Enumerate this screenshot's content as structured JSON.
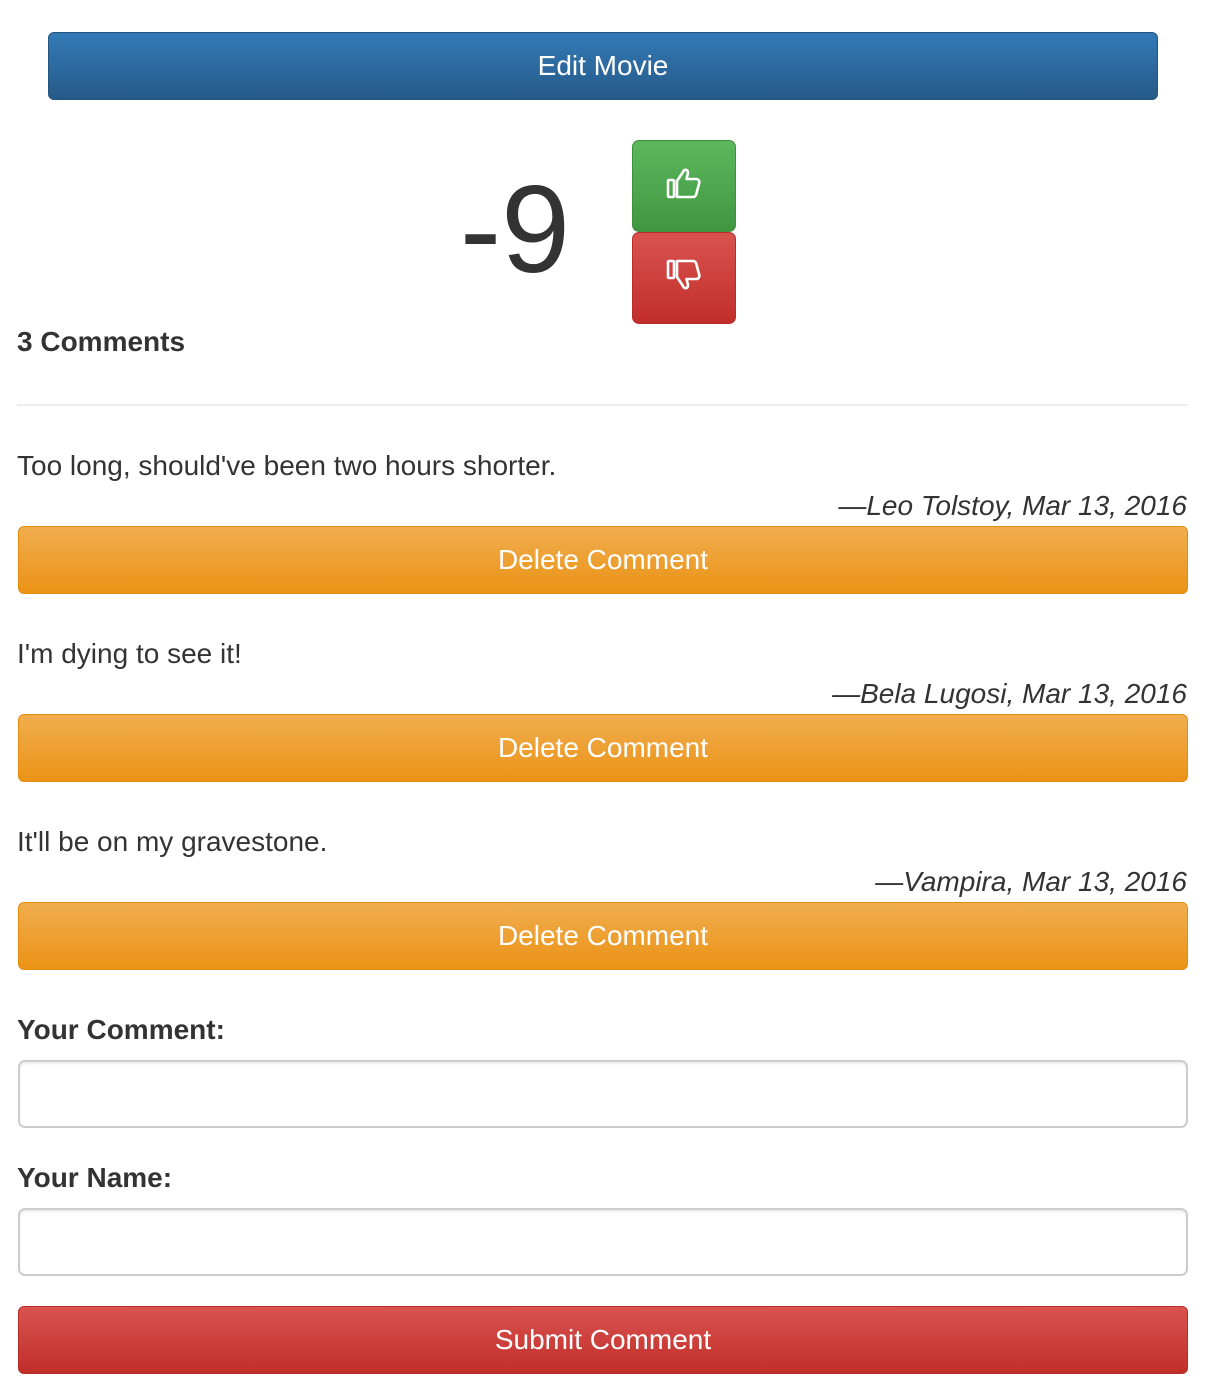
{
  "actions": {
    "edit_label": "Edit Movie"
  },
  "votes": {
    "score": "-9",
    "up_color": "#5cb85c",
    "down_color": "#d9534f"
  },
  "comments_section": {
    "count_label": "3 Comments",
    "items": [
      {
        "text": "Too long, should've been two hours shorter.",
        "meta": "—Leo Tolstoy, Mar 13, 2016",
        "delete_label": "Delete Comment"
      },
      {
        "text": "I'm dying to see it!",
        "meta": "—Bela Lugosi, Mar 13, 2016",
        "delete_label": "Delete Comment"
      },
      {
        "text": "It'll be on my gravestone.",
        "meta": "—Vampira, Mar 13, 2016",
        "delete_label": "Delete Comment"
      }
    ]
  },
  "form": {
    "comment_label": "Your Comment:",
    "comment_value": "",
    "name_label": "Your Name:",
    "name_value": "",
    "submit_label": "Submit Comment"
  },
  "colors": {
    "primary": "#337ab7",
    "warning": "#f0ad4e",
    "danger": "#d9534f",
    "success": "#5cb85c"
  },
  "icons": {
    "up": "thumbs-up-icon",
    "down": "thumbs-down-icon"
  }
}
